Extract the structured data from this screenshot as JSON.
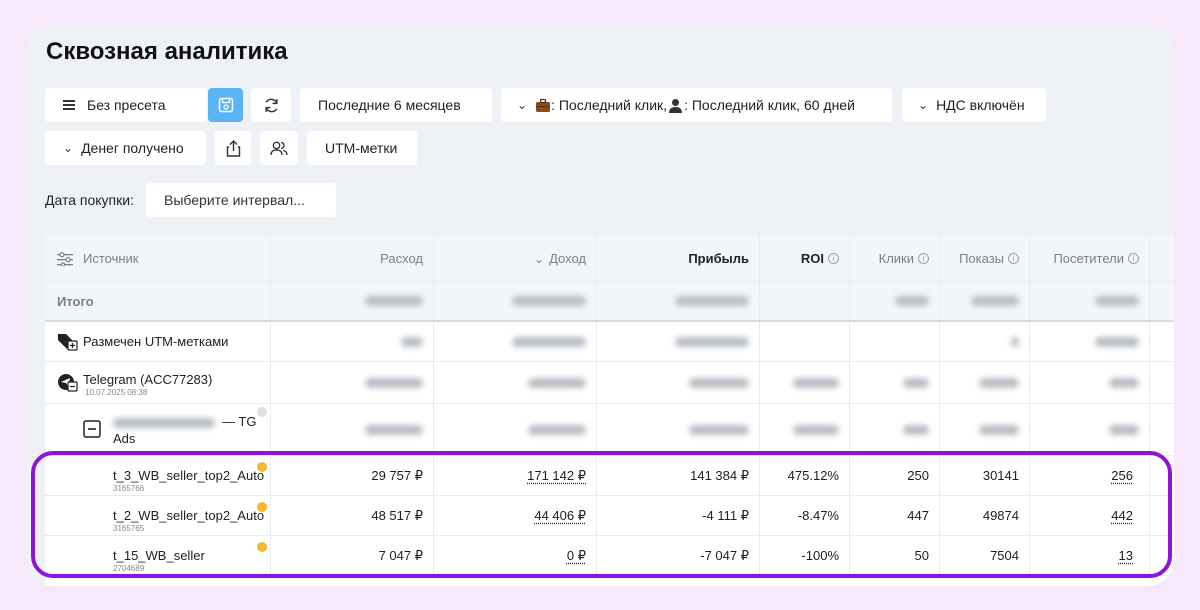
{
  "page": {
    "title": "Сквозная аналитика"
  },
  "toolbar": {
    "preset": "Без пресета",
    "period": "Последние 6 месяцев",
    "attribution_prefix": ": Последний клик, ",
    "attribution_suffix": ": Последний клик, 60 дней",
    "vat": "НДС включён",
    "money": "Денег получено",
    "utm": "UTM-метки"
  },
  "filter": {
    "label": "Дата покупки:",
    "placeholder": "Выберите интервал..."
  },
  "table": {
    "columns": {
      "source": "Источник",
      "expense": "Расход",
      "income": "Доход",
      "profit": "Прибыль",
      "roi": "ROI",
      "clicks": "Клики",
      "shows": "Показы",
      "visitors": "Посетители"
    },
    "total_label": "Итого",
    "groups": {
      "utm": {
        "name": "Размечен UTM-метками"
      },
      "telegram": {
        "name": "Telegram (ACC77283)",
        "date": "10.07.2025 08:38"
      },
      "tg_ads": {
        "suffix": "— TG",
        "suffix2": "Ads"
      }
    },
    "rows": [
      {
        "name": "t_3_WB_seller_top2_Auto",
        "id": "3165766",
        "expense": "29 757 ₽",
        "income": "171 142 ₽",
        "profit": "141 384 ₽",
        "roi": "475.12%",
        "clicks": "250",
        "shows": "30141",
        "visitors": "256"
      },
      {
        "name": "t_2_WB_seller_top2_Auto",
        "id": "3165765",
        "expense": "48 517 ₽",
        "income": "44 406 ₽",
        "profit": "-4 111 ₽",
        "roi": "-8.47%",
        "clicks": "447",
        "shows": "49874",
        "visitors": "442"
      },
      {
        "name": "t_15_WB_seller",
        "id": "2704689",
        "expense": "7 047 ₽",
        "income": "0 ₽",
        "profit": "-7 047 ₽",
        "roi": "-100%",
        "clicks": "50",
        "shows": "7504",
        "visitors": "13"
      }
    ]
  },
  "colors": {
    "accent": "#5ab4f5",
    "highlight": "#8d14d8",
    "status_dot": "#f5b731"
  },
  "icons": [
    "menu-icon",
    "save-icon",
    "refresh-icon",
    "chevron-down-icon",
    "briefcase-icon",
    "user-silhouette-icon",
    "share-icon",
    "users-icon",
    "sliders-icon",
    "info-icon",
    "tag-plus-icon",
    "telegram-icon",
    "collapse-icon"
  ]
}
